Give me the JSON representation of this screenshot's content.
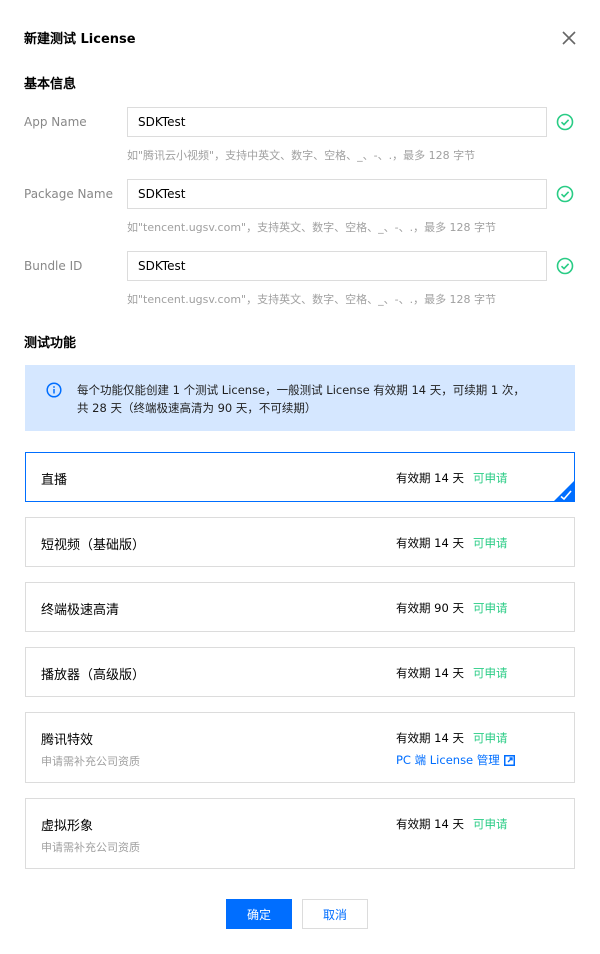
{
  "dialog": {
    "title": "新建测试 License"
  },
  "basic_info": {
    "section_title": "基本信息",
    "fields": [
      {
        "label": "App Name",
        "value": "SDKTest",
        "hint": "如\"腾讯云小视频\"，支持中英文、数字、空格、_、-、.，最多 128 字节"
      },
      {
        "label": "Package Name",
        "value": "SDKTest",
        "hint": "如\"tencent.ugsv.com\"，支持英文、数字、空格、_、-、.，最多 128 字节"
      },
      {
        "label": "Bundle ID",
        "value": "SDKTest",
        "hint": "如\"tencent.ugsv.com\"，支持英文、数字、空格、_、-、.，最多 128 字节"
      }
    ]
  },
  "test_features": {
    "section_title": "测试功能",
    "notice_line1": "每个功能仅能创建 1 个测试 License，一般测试 License 有效期 14 天，可续期 1 次，",
    "notice_line2": "共 28 天（终端极速高清为 90 天，不可续期）",
    "cards": [
      {
        "name": "直播",
        "validity": "有效期 14 天",
        "status": "可申请",
        "selected": true
      },
      {
        "name": "短视频（基础版）",
        "validity": "有效期 14 天",
        "status": "可申请"
      },
      {
        "name": "终端极速高清",
        "validity": "有效期 90 天",
        "status": "可申请"
      },
      {
        "name": "播放器（高级版）",
        "validity": "有效期 14 天",
        "status": "可申请"
      },
      {
        "name": "腾讯特效",
        "sub": "申请需补充公司资质",
        "validity": "有效期 14 天",
        "status": "可申请",
        "link": "PC 端 License 管理"
      },
      {
        "name": "虚拟形象",
        "sub": "申请需补充公司资质",
        "validity": "有效期 14 天",
        "status": "可申请"
      }
    ]
  },
  "footer": {
    "confirm_label": "确定",
    "cancel_label": "取消"
  },
  "colors": {
    "primary": "#006eff",
    "success": "#29cc85",
    "notice_bg": "#d5e7ff"
  }
}
